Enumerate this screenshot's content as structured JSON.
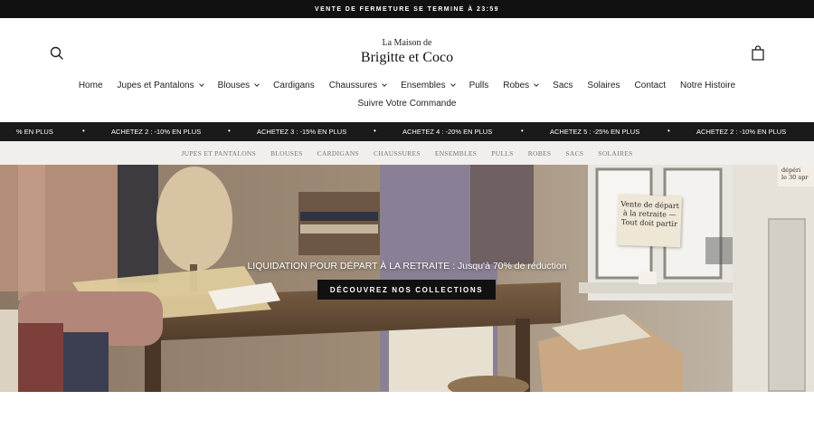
{
  "announcement": {
    "text": "VENTE DE FERMETURE SE TERMINE À 23:59"
  },
  "logo": {
    "line1": "La Maison de",
    "line2": "Brigitte et Coco"
  },
  "nav": {
    "row1": [
      {
        "label": "Home",
        "dropdown": false
      },
      {
        "label": "Jupes et Pantalons",
        "dropdown": true
      },
      {
        "label": "Blouses",
        "dropdown": true
      },
      {
        "label": "Cardigans",
        "dropdown": false
      },
      {
        "label": "Chaussures",
        "dropdown": true
      },
      {
        "label": "Ensembles",
        "dropdown": true
      },
      {
        "label": "Pulls",
        "dropdown": false
      },
      {
        "label": "Robes",
        "dropdown": true
      },
      {
        "label": "Sacs",
        "dropdown": false
      },
      {
        "label": "Solaires",
        "dropdown": false
      },
      {
        "label": "Contact",
        "dropdown": false
      },
      {
        "label": "Notre Histoire",
        "dropdown": false
      }
    ],
    "row2": [
      {
        "label": "Suivre Votre Commande",
        "dropdown": false
      }
    ]
  },
  "ticker": {
    "items": [
      "% EN PLUS",
      "ACHETEZ 2 : -10% EN PLUS",
      "ACHETEZ 3 : -15% EN PLUS",
      "ACHETEZ 4 : -20% EN PLUS",
      "ACHETEZ 5 : -25% EN PLUS",
      "ACHETEZ 2 : -10% EN PLUS"
    ],
    "separator": "•"
  },
  "categories": [
    "JUPES ET PANTALONS",
    "BLOUSES",
    "CARDIGANS",
    "CHAUSSURES",
    "ENSEMBLES",
    "PULLS",
    "ROBES",
    "SACS",
    "SOLAIRES"
  ],
  "hero": {
    "headline": "LIQUIDATION POUR DÉPART À LA RETRAITE : Jusqu'à 70% de réduction",
    "cta": "DÉCOUVREZ NOS COLLECTIONS",
    "sign_lines": [
      "Vente de départ",
      "à la retraite —",
      "Tout doit partir"
    ],
    "sign2_lines": [
      "dépéri",
      "le 30 apr"
    ]
  },
  "icons": {
    "search": "search-icon",
    "cart": "shopping-bag-icon"
  },
  "colors": {
    "dark": "#111111",
    "catbar": "#f1efec"
  }
}
